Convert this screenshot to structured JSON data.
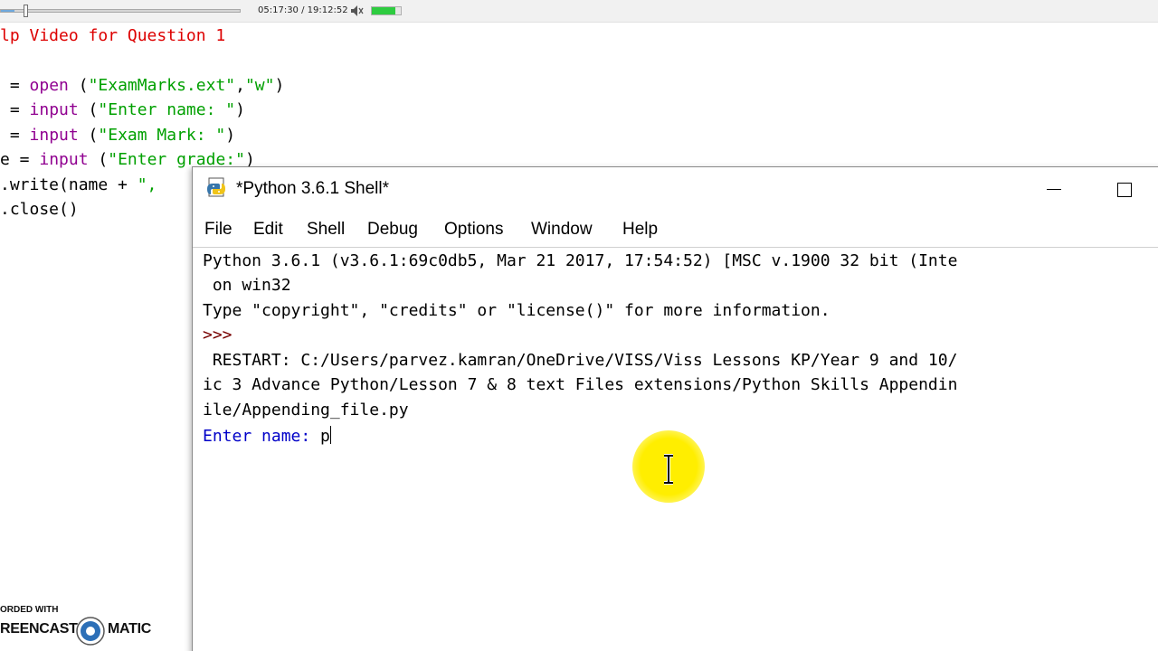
{
  "player": {
    "time": "05:17:30 / 19:12:52",
    "progress_fraction": 0.055,
    "volume_fraction": 0.82,
    "icons": [
      "speaker-icon"
    ]
  },
  "editor": {
    "lines": [
      {
        "parts": [
          {
            "t": "lp Video for Question 1",
            "c": "comment"
          }
        ]
      },
      {
        "parts": [
          {
            "t": "",
            "c": "plain"
          }
        ]
      },
      {
        "parts": [
          {
            "t": " = ",
            "c": "plain"
          },
          {
            "t": "open",
            "c": "kw-builtin"
          },
          {
            "t": " (",
            "c": "plain"
          },
          {
            "t": "\"ExamMarks.ext\"",
            "c": "str"
          },
          {
            "t": ",",
            "c": "plain"
          },
          {
            "t": "\"w\"",
            "c": "str"
          },
          {
            "t": ")",
            "c": "plain"
          }
        ]
      },
      {
        "parts": [
          {
            "t": " = ",
            "c": "plain"
          },
          {
            "t": "input",
            "c": "kw-builtin"
          },
          {
            "t": " (",
            "c": "plain"
          },
          {
            "t": "\"Enter name: \"",
            "c": "str"
          },
          {
            "t": ")",
            "c": "plain"
          }
        ]
      },
      {
        "parts": [
          {
            "t": " = ",
            "c": "plain"
          },
          {
            "t": "input",
            "c": "kw-builtin"
          },
          {
            "t": " (",
            "c": "plain"
          },
          {
            "t": "\"Exam Mark: \"",
            "c": "str"
          },
          {
            "t": ")",
            "c": "plain"
          }
        ]
      },
      {
        "parts": [
          {
            "t": "e = ",
            "c": "plain"
          },
          {
            "t": "input",
            "c": "kw-builtin"
          },
          {
            "t": " (",
            "c": "plain"
          },
          {
            "t": "\"Enter grade:\"",
            "c": "str"
          },
          {
            "t": ")",
            "c": "plain"
          }
        ]
      },
      {
        "parts": [
          {
            "t": ".write(name + ",
            "c": "plain"
          },
          {
            "t": "\",",
            "c": "str"
          }
        ]
      },
      {
        "parts": [
          {
            "t": ".close()",
            "c": "plain"
          }
        ]
      }
    ]
  },
  "shell": {
    "title": "*Python 3.6.1 Shell*",
    "menu": [
      "File",
      "Edit",
      "Shell",
      "Debug",
      "Options",
      "Window",
      "Help"
    ],
    "lines": [
      {
        "text": "Python 3.6.1 (v3.6.1:69c0db5, Mar 21 2017, 17:54:52) [MSC v.1900 32 bit (Inte",
        "c": "plain"
      },
      {
        "text": " on win32",
        "c": "plain"
      },
      {
        "text": "Type \"copyright\", \"credits\" or \"license()\" for more information.",
        "c": "plain"
      },
      {
        "text": ">>> ",
        "c": "prompt-color"
      },
      {
        "text": " RESTART: C:/Users/parvez.kamran/OneDrive/VISS/Viss Lessons KP/Year 9 and 10/",
        "c": "restart-color"
      },
      {
        "text": "ic 3 Advance Python/Lesson 7 & 8 text Files extensions/Python Skills Appendin",
        "c": "restart-color"
      },
      {
        "text": "ile/Appending_file.py",
        "c": "restart-color"
      }
    ],
    "input_prompt": "Enter name: ",
    "input_value": "p"
  },
  "watermark": {
    "top": "ORDED WITH",
    "left": "REENCAST",
    "right": "MATIC"
  }
}
